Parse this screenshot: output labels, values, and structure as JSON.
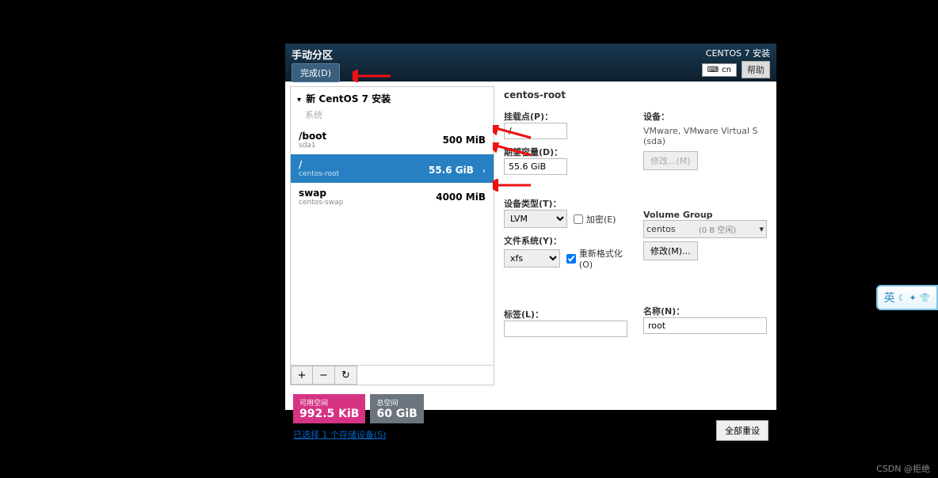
{
  "header": {
    "title": "手动分区",
    "done": "完成(D)",
    "install_title": "CENTOS 7 安装",
    "keyboard": "cn",
    "help": "帮助"
  },
  "left": {
    "heading": "新 CentOS 7 安装",
    "system_label": "系统",
    "partitions": [
      {
        "name": "/boot",
        "device": "sda1",
        "size": "500 MiB",
        "selected": false
      },
      {
        "name": "/",
        "device": "centos-root",
        "size": "55.6 GiB",
        "selected": true
      },
      {
        "name": "swap",
        "device": "centos-swap",
        "size": "4000 MiB",
        "selected": false
      }
    ],
    "toolbar": {
      "add": "+",
      "remove": "−",
      "reload": "↻"
    }
  },
  "detail": {
    "title": "centos-root",
    "mount_label": "挂载点(P)：",
    "mount_value": "/",
    "capacity_label": "期望容量(D)：",
    "capacity_value": "55.6 GiB",
    "device_type_label": "设备类型(T)：",
    "device_type_value": "LVM",
    "encrypt_label": "加密(E)",
    "fs_label": "文件系统(Y)：",
    "fs_value": "xfs",
    "reformat_label": "重新格式化(O)",
    "label_label": "标签(L)：",
    "label_value": "",
    "devices_label": "设备：",
    "devices_value": "VMware, VMware Virtual S (sda)",
    "modify_btn": "修改...(M)",
    "vg_label": "Volume Group",
    "vg_value": "centos",
    "vg_free": "(0 B 空闲)",
    "vg_modify": "修改(M)...",
    "name_label": "名称(N)：",
    "name_value": "root"
  },
  "bottom": {
    "avail_label": "可用空间",
    "avail_value": "992.5 KiB",
    "total_label": "总空间",
    "total_value": "60 GiB",
    "storage_link": "已选择 1 个存储设备(S)",
    "reset": "全部重设"
  },
  "ime": "英",
  "watermark": "CSDN @拒绝"
}
